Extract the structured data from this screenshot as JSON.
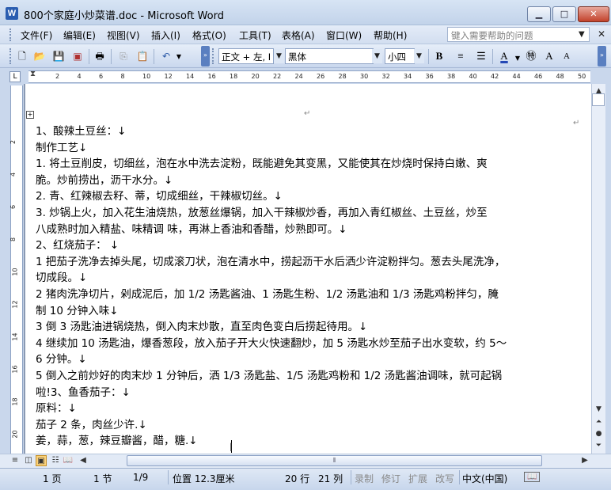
{
  "window": {
    "title": "800个家庭小炒菜谱.doc - Microsoft Word",
    "app_icon": "W",
    "minimize": "▁",
    "maximize": "□",
    "close": "✕"
  },
  "menu": {
    "items": [
      "文件(F)",
      "编辑(E)",
      "视图(V)",
      "插入(I)",
      "格式(O)",
      "工具(T)",
      "表格(A)",
      "窗口(W)",
      "帮助(H)"
    ],
    "help_placeholder": "键入需要帮助的问题"
  },
  "toolbar": {
    "style_combo": "正文 + 左, I",
    "font_combo": "黑体",
    "size_combo": "小四",
    "bold": "B",
    "align_left": "≡",
    "align_distribute": "☰",
    "font_color": "A",
    "phonetic": "㊕",
    "grow_font": "A",
    "shrink_font": "A"
  },
  "ruler": {
    "corner": "L",
    "numbers": [
      "2",
      "4",
      "6",
      "8",
      "10",
      "12",
      "14",
      "16",
      "18",
      "20",
      "22",
      "24",
      "26",
      "28",
      "30",
      "32",
      "34",
      "36",
      "38",
      "40",
      "42",
      "44",
      "46",
      "48",
      "50"
    ],
    "vertical_numbers": [
      "2",
      "4",
      "6",
      "8",
      "10",
      "12",
      "14",
      "16",
      "18",
      "20"
    ]
  },
  "document": {
    "lines": [
      "1、酸辣土豆丝：↓",
      "制作工艺↓",
      "1.  将土豆削皮，切细丝，泡在水中洗去淀粉，既能避免其变黑，又能使其在炒烧时保持白嫩、爽",
      "脆。炒前捞出，沥干水分。↓",
      "2.  青、红辣椒去籽、蒂，切成细丝，干辣椒切丝。↓",
      "3.  炒锅上火，加入花生油烧热，放葱丝爆锅，加入干辣椒炒香，再加入青红椒丝、土豆丝，炒至",
      "八成熟时加入精盐、味精调 味，再淋上香油和香醋，炒熟即可。↓",
      "2、红烧茄子： ↓",
      "1 把茄子洗净去掉头尾，切成滚刀状，泡在清水中，捞起沥干水后洒少许淀粉拌匀。葱去头尾洗净，",
      "切成段。↓",
      "2 猪肉洗净切片，剁成泥后，加 1/2 汤匙酱油、1 汤匙生粉、1/2 汤匙油和 1/3 汤匙鸡粉拌匀，腌",
      "制 10 分钟入味↓",
      "3 倒 3 汤匙油进锅烧热，倒入肉末炒散，直至肉色变白后捞起待用。↓",
      "4 继续加 10 汤匙油，爆香葱段，放入茄子开大火快速翻炒，加 5 汤匙水炒至茄子出水变软，约 5～",
      "6 分钟。↓",
      "5 倒入之前炒好的肉末炒 1 分钟后，洒 1/3 汤匙盐、1/5 汤匙鸡粉和 1/2 汤匙酱油调味，就可起锅",
      "啦!3、鱼香茄子：↓",
      "原料：↓",
      "茄子  2 条，肉丝少许.↓",
      "姜，蒜，葱，辣豆瓣酱，醋，糖.↓"
    ]
  },
  "statusbar": {
    "page": "1 页",
    "section": "1 节",
    "page_of": "1/9",
    "position": "位置 12.3厘米",
    "line": "20 行",
    "column": "21 列",
    "rec": "录制",
    "trk": "修订",
    "ext": "扩展",
    "ovr": "改写",
    "language": "中文(中国)"
  }
}
